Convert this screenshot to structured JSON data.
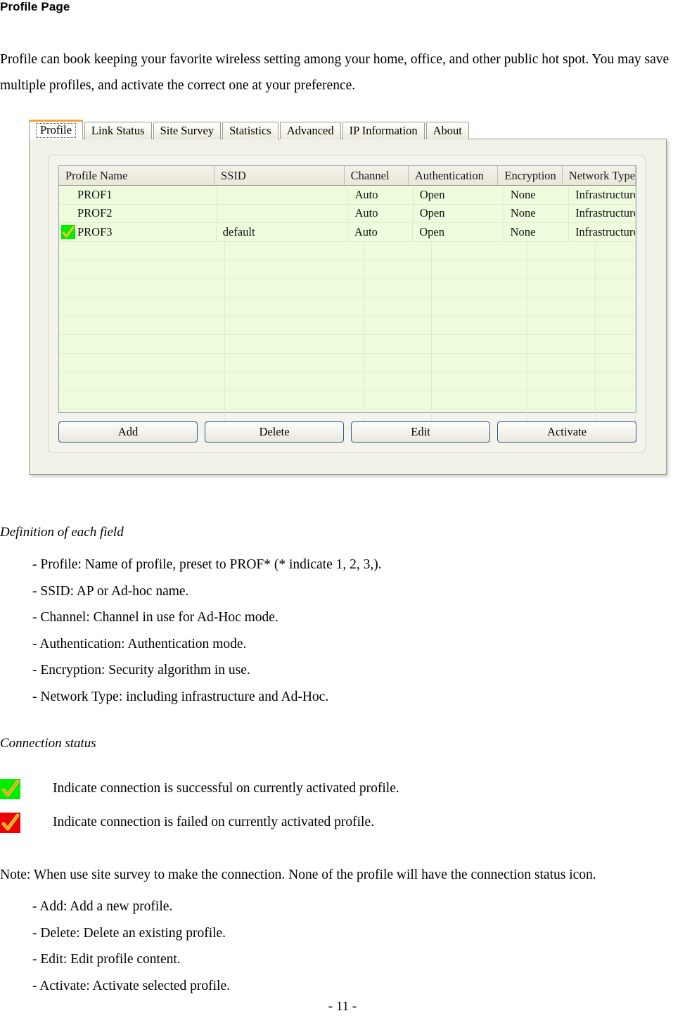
{
  "document": {
    "title": "Profile Page",
    "intro": "Profile can book keeping your favorite wireless setting among your home, office, and other public hot spot. You may save multiple profiles, and activate the correct one at your preference.",
    "definition_heading": "Definition of each field",
    "field_definitions": [
      "- Profile: Name of profile, preset to PROF* (* indicate 1, 2, 3,).",
      "- SSID: AP or Ad-hoc name.",
      "- Channel: Channel in use for Ad-Hoc mode.",
      "- Authentication: Authentication mode.",
      "- Encryption: Security algorithm in use.",
      "- Network Type: including infrastructure and Ad-Hoc."
    ],
    "connection_heading": "Connection status",
    "connection_statuses": [
      {
        "icon": "green-check-icon",
        "bg_color": "#00ee00",
        "check_color": "#e8c02a",
        "text": "Indicate connection is successful on currently activated profile."
      },
      {
        "icon": "red-check-icon",
        "bg_color": "#ee0000",
        "check_color": "#e8c02a",
        "text": "Indicate connection is failed on currently activated profile."
      }
    ],
    "note": "Note: When use site survey to make the connection. None of the profile will have the connection status icon.",
    "button_definitions": [
      "- Add: Add a new profile.",
      "- Delete: Delete an existing profile.",
      "- Edit: Edit profile content.",
      "- Activate: Activate selected profile."
    ],
    "footer": "- 11 -"
  },
  "app": {
    "accent_color": "#f2a23c",
    "tabs": [
      {
        "label": "Profile",
        "active": true
      },
      {
        "label": "Link Status",
        "active": false
      },
      {
        "label": "Site Survey",
        "active": false
      },
      {
        "label": "Statistics",
        "active": false
      },
      {
        "label": "Advanced",
        "active": false
      },
      {
        "label": "IP Information",
        "active": false
      },
      {
        "label": "About",
        "active": false
      }
    ],
    "grid": {
      "columns": [
        "Profile Name",
        "SSID",
        "Channel",
        "Authentication",
        "Encryption",
        "Network Type"
      ],
      "rows": [
        {
          "status_icon": null,
          "profile_name": "PROF1",
          "ssid": "",
          "channel": "Auto",
          "authentication": "Open",
          "encryption": "None",
          "network_type": "Infrastructure"
        },
        {
          "status_icon": null,
          "profile_name": "PROF2",
          "ssid": "",
          "channel": "Auto",
          "authentication": "Open",
          "encryption": "None",
          "network_type": "Infrastructure"
        },
        {
          "status_icon": "green-check-icon",
          "profile_name": "PROF3",
          "ssid": "default",
          "channel": "Auto",
          "authentication": "Open",
          "encryption": "None",
          "network_type": "Infrastructure"
        }
      ],
      "empty_row_count": 10
    },
    "buttons": [
      "Add",
      "Delete",
      "Edit",
      "Activate"
    ]
  }
}
